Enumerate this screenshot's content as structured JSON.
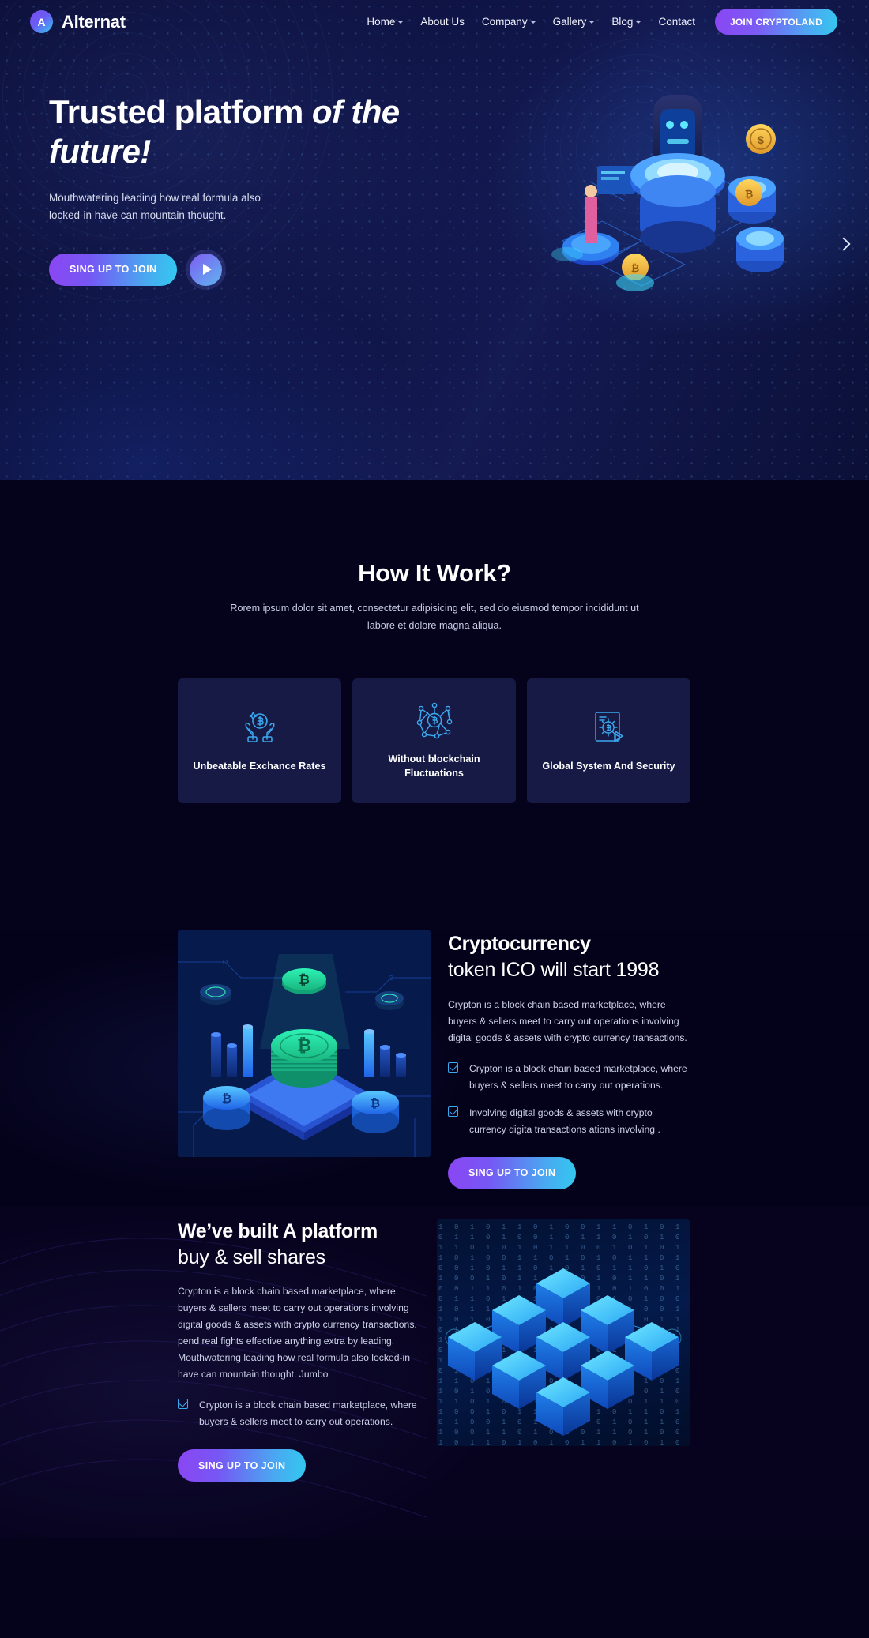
{
  "header": {
    "logo_letter": "A",
    "brand": "Alternat",
    "nav": [
      {
        "label": "Home",
        "dropdown": true
      },
      {
        "label": "About Us",
        "dropdown": false
      },
      {
        "label": "Company",
        "dropdown": true
      },
      {
        "label": "Gallery",
        "dropdown": true
      },
      {
        "label": "Blog",
        "dropdown": true
      },
      {
        "label": "Contact",
        "dropdown": false
      }
    ],
    "cta": "JOIN CRYPTOLAND"
  },
  "hero": {
    "title_plain": "Trusted platform ",
    "title_em": "of the future!",
    "subtitle": "Mouthwatering leading how real formula also locked-in have can mountain thought.",
    "primary_button": "SING UP TO JOIN",
    "play_button": "play-button",
    "next_arrow": "next-slide-arrow"
  },
  "how_it_work": {
    "title": "How It Work?",
    "subtitle": "Rorem ipsum dolor sit amet, consectetur adipisicing elit, sed do eiusmod tempor incididunt ut labore et dolore magna aliqua.",
    "cards": [
      {
        "icon": "hands-holding-bitcoin-icon",
        "label": "Unbeatable Exchance Rates"
      },
      {
        "icon": "blockchain-network-bitcoin-icon",
        "label": "Without blockchain Fluctuations"
      },
      {
        "icon": "secure-chip-document-icon",
        "label": "Global System And Security"
      }
    ]
  },
  "crypto": {
    "heading_bold": "Cryptocurrency",
    "heading_light": "token ICO will start 1998",
    "paragraph": "Crypton is a block chain based marketplace, where buyers & sellers meet to carry out operations involving digital goods & assets with crypto currency transactions.",
    "checks": [
      "Crypton is a block chain based marketplace, where buyers & sellers meet to carry out operations.",
      "Involving digital goods & assets with crypto currency digita transactions ations involving ."
    ],
    "button": "SING UP TO JOIN",
    "image_alt": "isometric-crypto-coins-chart-illustration"
  },
  "built": {
    "heading_bold": "We’ve built A platform",
    "heading_light": "buy & sell shares",
    "paragraph": "Crypton is a block chain based marketplace, where buyers & sellers meet to carry out operations involving digital goods & assets with crypto currency transactions. pend real fights effective anything extra by leading. Mouthwatering leading how real formula also locked-in have can mountain thought. Jumbo",
    "checks": [
      "Crypton is a block chain based marketplace, where buyers & sellers meet to carry out operations."
    ],
    "button": "SING UP TO JOIN",
    "image_alt": "blockchain-cubes-binary-illustration",
    "binary": "1 0 1 0 1 1 0 1 0 0 1 1 0 1 0 1 0 1 1 0 1 0 0 1 0 1 1 0 1 0 1 0 1 1 0 1 0 1 0 1 1 0 0 1 0 1 0 1 1 0 1 0 0 1 1 0 1 0 1 0 1 1 0 1 0 0 1 0 1 1 0 1 0 1 0 1 1 0 1 0 1 0 0 1 0 1 1 0 1 0 1 0 1 1 0 1 0 0 1 1 0 1 0 1 0 1 1 0 1 0 0 1 0 1 1 0 1 0 1 0 1 1 0 1 0 1 0 0 1 0 1 1 0 1 0 1 0 1 1 0 1 0 0 1 1 0 1 0 1 0 1 1 0 1 0 0 1 0 1 1 0 1 0 1 0 1 1 0 1 0 1 0 0 1 0 1 1 0 1 0 1 0 1 1 0 1 0 0 1 1 0 1 0 1 0 1 1 0 1 0 0 1 0 1 1 0 1 0 1 0 1 1 0 1 0 1 0 0 1 0 1 1 0 1 0 1 0 1 1 0 1 0 0 1 1 0 1 0 1 0 1 1 0 1 0 0 1 0 1 1 0 1 0 1 0 1 1 0 1 0 1 0 0 1 0 1 1 0 1 0 1 0 1 1 0 1 0 0 1 1 0 1 0 1 0 1 1 0 1 0 0 1 0 1 1 0 1 0 1 0 1 1 0 1 0 1 0 0 1 0 1 1 0 1 0 1 0 1 1 0 1 0 0 1 1 0 1 0 1 0 1 1 0 1 0 0 1 0 1 1 0 1 0 1 0 1 1 0 1 0 1 0 0 1 0 1 1 0 1 0 1 0 1 1 0 1 0 0 1 1 0 1 0 1 0 1 1 0 1 0 0 1 0 1 1 0 1 0 1 0 1 1 0 1 0 1 0 0 1 0 1 1 0 1 0 1 0 1 1 0 1 0 0 1 1 0 1 0 1 0 1 1 0 1 0 0 1 0 1 1 0 1 0 1 0 1 1 0 1 0 1 0 0 1 0 1 1 0 1 0 1 0 1 1 0 1 0 0 1 1 0 1 0 1 0 1 1 0 1 0 0 1 0 1 1 0 1 0 1 0 1 1 0 1 0 1 0 0 1 0 1 1 0 1 0 1 0 1 1 0 1 0"
  },
  "colors": {
    "accent_purple": "#8b46f3",
    "accent_cyan": "#32c9ef",
    "card_bg": "#161a45",
    "page_bg": "#05021c",
    "icon_line": "#3ba8ef"
  }
}
